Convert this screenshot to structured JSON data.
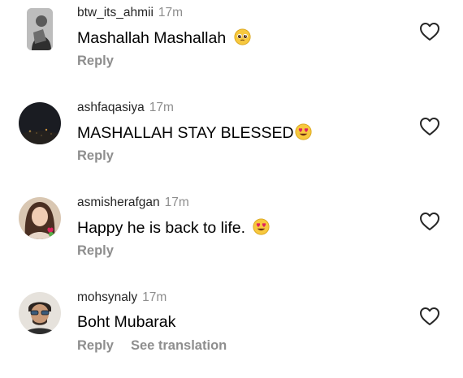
{
  "comments": [
    {
      "username": "btw_its_ahmii",
      "time": "17m",
      "text": "Mashallah Mashallah",
      "emoji": "pleading-face",
      "reply_label": "Reply"
    },
    {
      "username": "ashfaqasiya",
      "time": "17m",
      "text": "MASHALLAH STAY BLESSED",
      "emoji": "heart-eyes-face",
      "reply_label": "Reply"
    },
    {
      "username": "asmisherafgan",
      "time": "17m",
      "text": "Happy he is back to life.",
      "emoji": "heart-eyes-face",
      "reply_label": "Reply"
    },
    {
      "username": "mohsynaly",
      "time": "17m",
      "text": "Boht Mubarak",
      "emoji": "",
      "reply_label": "Reply",
      "translate_label": "See translation"
    }
  ],
  "colors": {
    "text": "#000000",
    "username": "#262626",
    "muted": "#8e8e8e",
    "background": "#ffffff"
  },
  "icons": {
    "like": "heart-outline-icon"
  }
}
